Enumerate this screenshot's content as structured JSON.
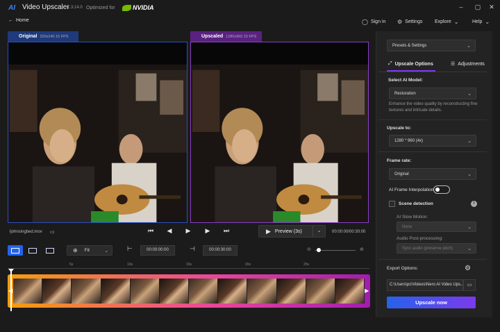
{
  "app": {
    "logo": "AI",
    "title": "Video Upscaler",
    "version": "1.3.14.0",
    "optimized_for": "Optimized for",
    "nvidia": "NVIDIA"
  },
  "nav": {
    "home": "Home",
    "sign_in": "Sign in",
    "settings": "Settings",
    "explore": "Explore",
    "help": "Help"
  },
  "viewer": {
    "original_label": "Original",
    "original_info": "320x240 15 FPS",
    "upscaled_label": "Upscaled",
    "upscaled_info": "1280x960 15 FPS"
  },
  "player": {
    "file_name": "ljohnsingbed.mov",
    "preview_label": "Preview (3s)",
    "time_display": "00:00:00/00:30:00"
  },
  "toolbar": {
    "zoom_value": "Fit",
    "trim_start": "00:00:00:00",
    "trim_end": "00:00:30:00"
  },
  "timeline": {
    "ticks": [
      "5s",
      "10s",
      "15s",
      "20s",
      "25s"
    ],
    "playhead_position": 0
  },
  "panel": {
    "presets": "Presets & Settings",
    "tab_upscale": "Upscale Options",
    "tab_adjust": "Adjustments",
    "select_model_label": "Select AI Model:",
    "model_value": "Restoration",
    "model_desc": "Enhance the video quality by reconstructing fine textures and intricate details.",
    "upscale_to_label": "Upscale to:",
    "upscale_value": "1280 * 960 (4x)",
    "frame_rate_label": "Frame rate:",
    "frame_rate_value": "Original",
    "interp_label": "AI Frame Interpolation",
    "scene_label": "Scene detection",
    "slow_motion_label": "AI Slow Motion:",
    "slow_motion_value": "None",
    "post_label": "Audio Post-processing:",
    "post_value": "Sync audio (preserve pitch)",
    "export_label": "Export Options:",
    "export_path": "C:\\Users\\pc\\Videos\\Nero AI Video Ups...",
    "upscale_button": "Upscale now"
  },
  "colors": {
    "accent_blue": "#2563eb",
    "accent_purple": "#7c3aed",
    "nvidia_green": "#76b900"
  }
}
